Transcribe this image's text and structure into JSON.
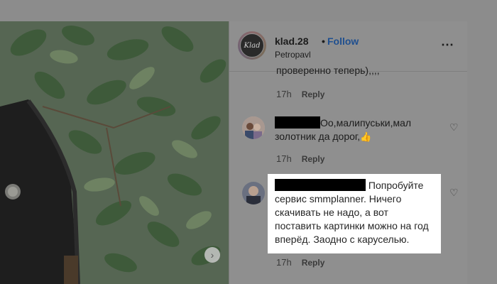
{
  "post": {
    "username": "klad.28",
    "dot": "•",
    "follow_label": "Follow",
    "location": "Petropavl",
    "avatar_text": "Klad",
    "more_icon": "⋯"
  },
  "comments": [
    {
      "text": "проверенно теперь),,,,",
      "time": "17h",
      "reply": "Reply"
    },
    {
      "text": "Оо,малипуськи,мал золотник да дорог,",
      "emoji": "👍",
      "time": "17h",
      "reply": "Reply"
    },
    {
      "text": "Попробуйте сервис smmplanner. Ничего скачивать не надо, а вот поставить картинки можно на год вперёд. Заодно с каруселью.",
      "time": "17h",
      "reply": "Reply"
    }
  ],
  "icons": {
    "next": "›",
    "heart": "♡"
  }
}
